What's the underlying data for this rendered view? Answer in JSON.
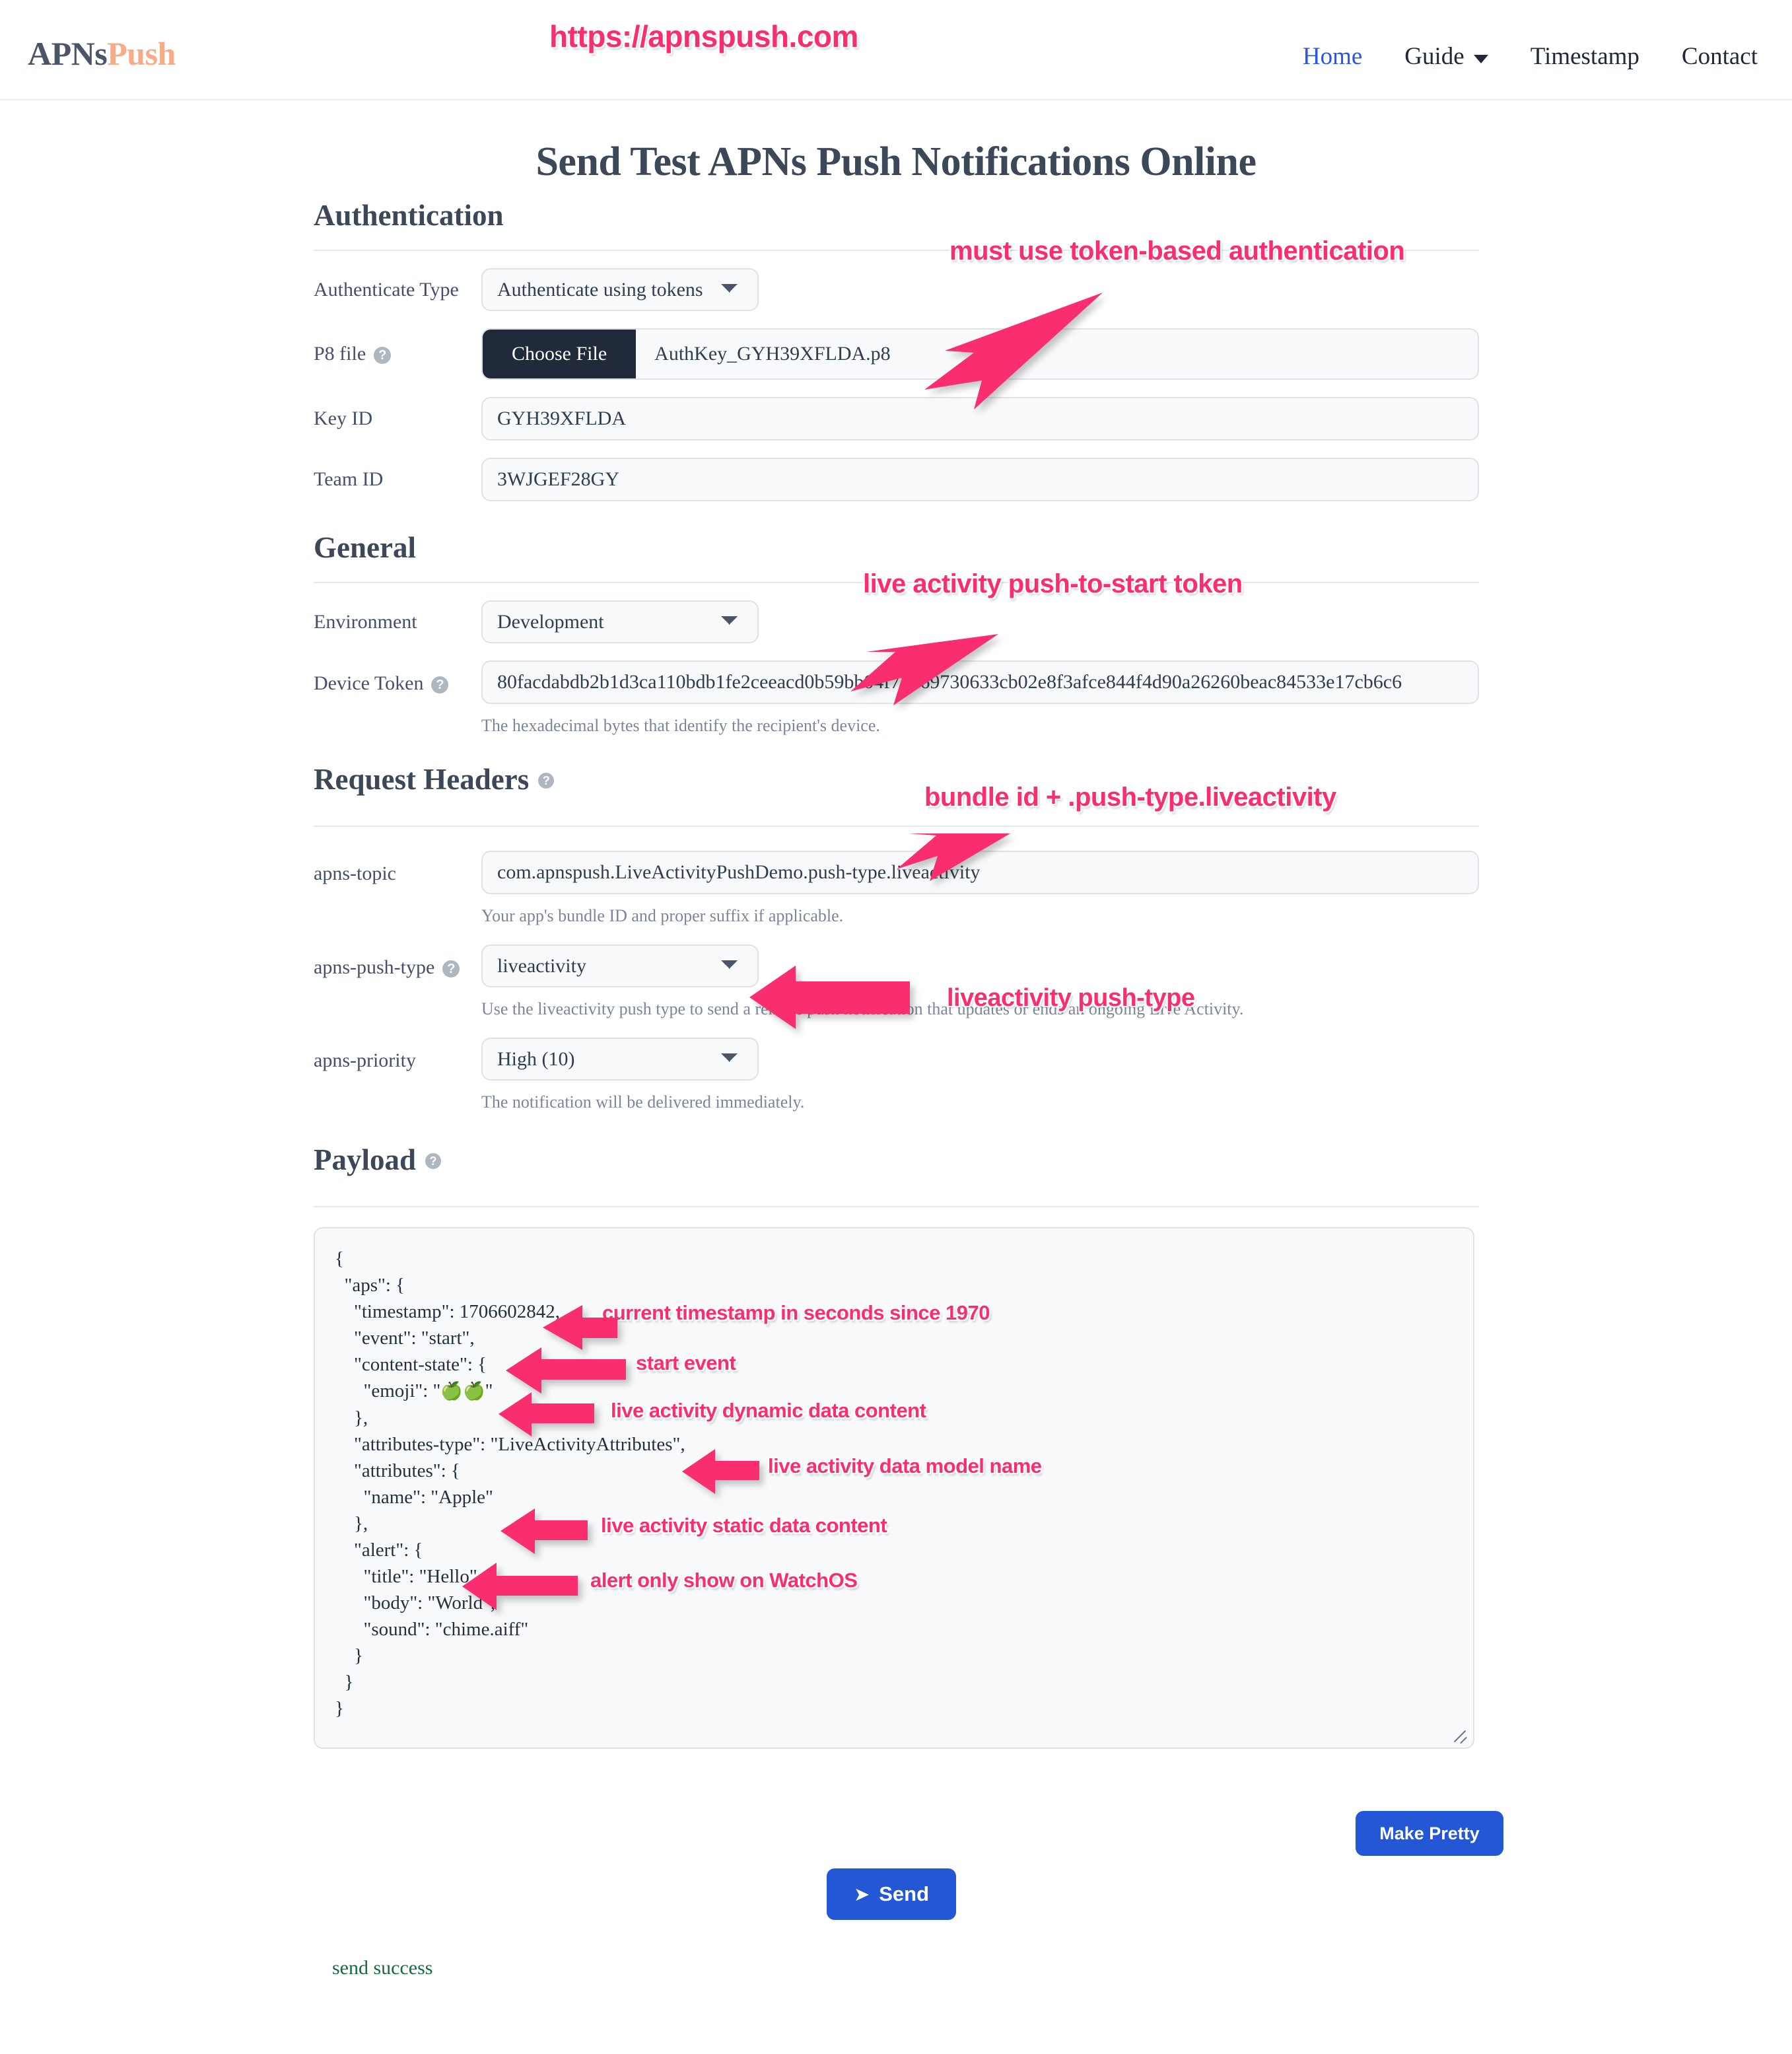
{
  "navbar": {
    "brand_primary": "APNs",
    "brand_secondary": "Push",
    "links": [
      {
        "label": "Home",
        "active": true
      },
      {
        "label": "Guide",
        "active": false,
        "caret": true
      },
      {
        "label": "Timestamp",
        "active": false
      },
      {
        "label": "Contact",
        "active": false
      }
    ]
  },
  "page": {
    "title": "Send Test APNs Push Notifications Online"
  },
  "authentication": {
    "heading": "Authentication",
    "authenticate_type_label": "Authenticate Type",
    "authenticate_type_value": "Authenticate using tokens",
    "p8_label": "P8 file",
    "p8_button": "Choose File",
    "p8_filename": "AuthKey_GYH39XFLDA.p8",
    "key_id_label": "Key ID",
    "key_id_value": "GYH39XFLDA",
    "team_id_label": "Team ID",
    "team_id_value": "3WJGEF28GY"
  },
  "general": {
    "heading": "General",
    "environment_label": "Environment",
    "environment_value": "Development",
    "device_token_label": "Device Token",
    "device_token_value": "80facdabdb2b1d3ca110bdb1fe2ceeacd0b59bb04f72069730633cb02e8f3afce844f4d90a26260beac84533e17cb6c6",
    "device_token_hint": "The hexadecimal bytes that identify the recipient's device."
  },
  "request_headers": {
    "heading": "Request Headers",
    "apns_topic_label": "apns-topic",
    "apns_topic_value": "com.apnspush.LiveActivityPushDemo.push-type.liveactivity",
    "apns_topic_hint": "Your app's bundle ID and proper suffix if applicable.",
    "apns_push_type_label": "apns-push-type",
    "apns_push_type_value": "liveactivity",
    "apns_push_type_hint": "Use the liveactivity push type to send a remote push notification that updates or ends an ongoing Live Activity.",
    "apns_priority_label": "apns-priority",
    "apns_priority_value": "High (10)",
    "apns_priority_hint": "The notification will be delivered immediately."
  },
  "payload": {
    "heading": "Payload",
    "json_part1": "{\n  \"aps\": {\n    \"timestamp\": 1706602842,\n    \"event\": \"start\",\n    \"content-state\": {\n      \"emoji\": \"",
    "emoji": "🍏🍏",
    "json_part2": "\"\n    },\n    \"attributes-type\": \"LiveActivityAttributes\",\n    \"attributes\": {\n      \"name\": \"Apple\"\n    },\n    \"alert\": {\n      \"title\": \"Hello\",\n      \"body\": \"World\",\n      \"sound\": \"chime.aiff\"\n    }\n  }\n}"
  },
  "actions": {
    "make_pretty": "Make Pretty",
    "send": "Send",
    "send_icon": "paper-plane-icon",
    "status": "send success"
  },
  "annotations": {
    "url": "https://apnspush.com",
    "token_auth": "must use token-based authentication",
    "push_to_start": "live activity push-to-start token",
    "bundle_id": "bundle id  + .push-type.liveactivity",
    "push_type": "liveactivity push-type",
    "timestamp": "current timestamp in seconds since 1970",
    "start_event": "start event",
    "dynamic_data": "live activity dynamic data content",
    "data_model": "live activity data model name",
    "static_data": "live activity static data content",
    "alert_watchos": "alert only show on WatchOS"
  },
  "colors": {
    "annotation": "#f92e6e",
    "primary_button": "#2357d6",
    "brand_secondary": "#f6ad87",
    "success": "#17693f",
    "nav_active": "#2a55e5"
  }
}
